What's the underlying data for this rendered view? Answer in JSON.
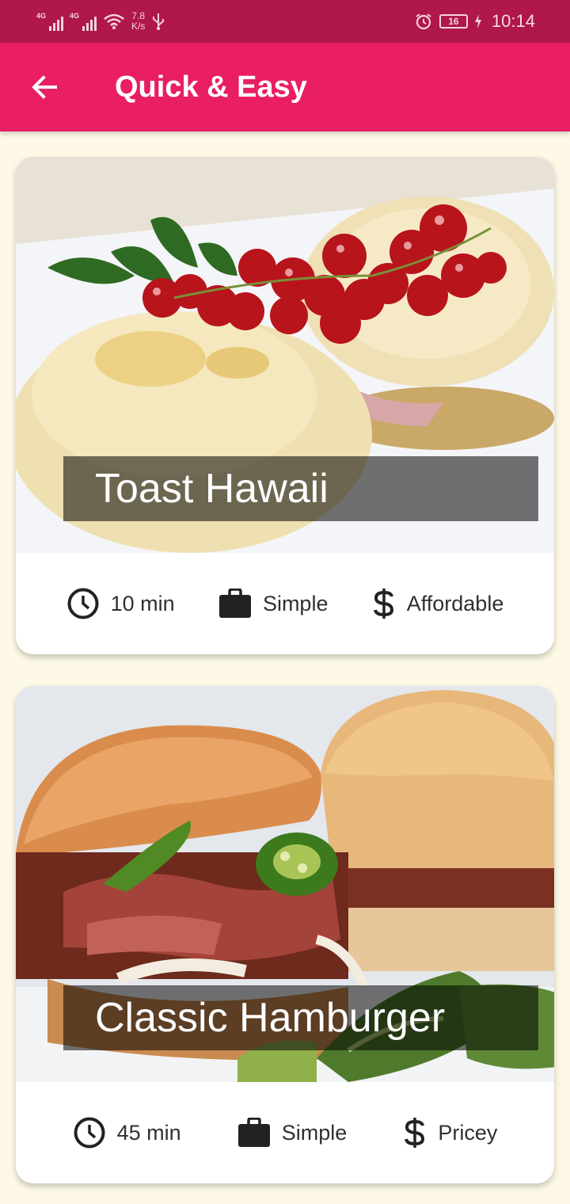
{
  "status_bar": {
    "network_1": "4G",
    "network_2": "4G",
    "speed_value": "7.8",
    "speed_unit": "K/s",
    "battery": "16",
    "time": "10:14",
    "icons": [
      "signal-icon",
      "wifi-icon",
      "usb-icon",
      "alarm-icon",
      "battery-icon",
      "charging-icon"
    ]
  },
  "app_bar": {
    "back_icon": "arrow-back-icon",
    "title": "Quick & Easy",
    "background": "#e91e63"
  },
  "meals": [
    {
      "title": "Toast Hawaii",
      "duration": "10 min",
      "complexity": "Simple",
      "affordability": "Affordable"
    },
    {
      "title": "Classic Hamburger",
      "duration": "45 min",
      "complexity": "Simple",
      "affordability": "Pricey"
    }
  ],
  "colors": {
    "status_bar": "#b0174d",
    "accent": "#e91e63",
    "page_background": "#fdf9e6"
  }
}
